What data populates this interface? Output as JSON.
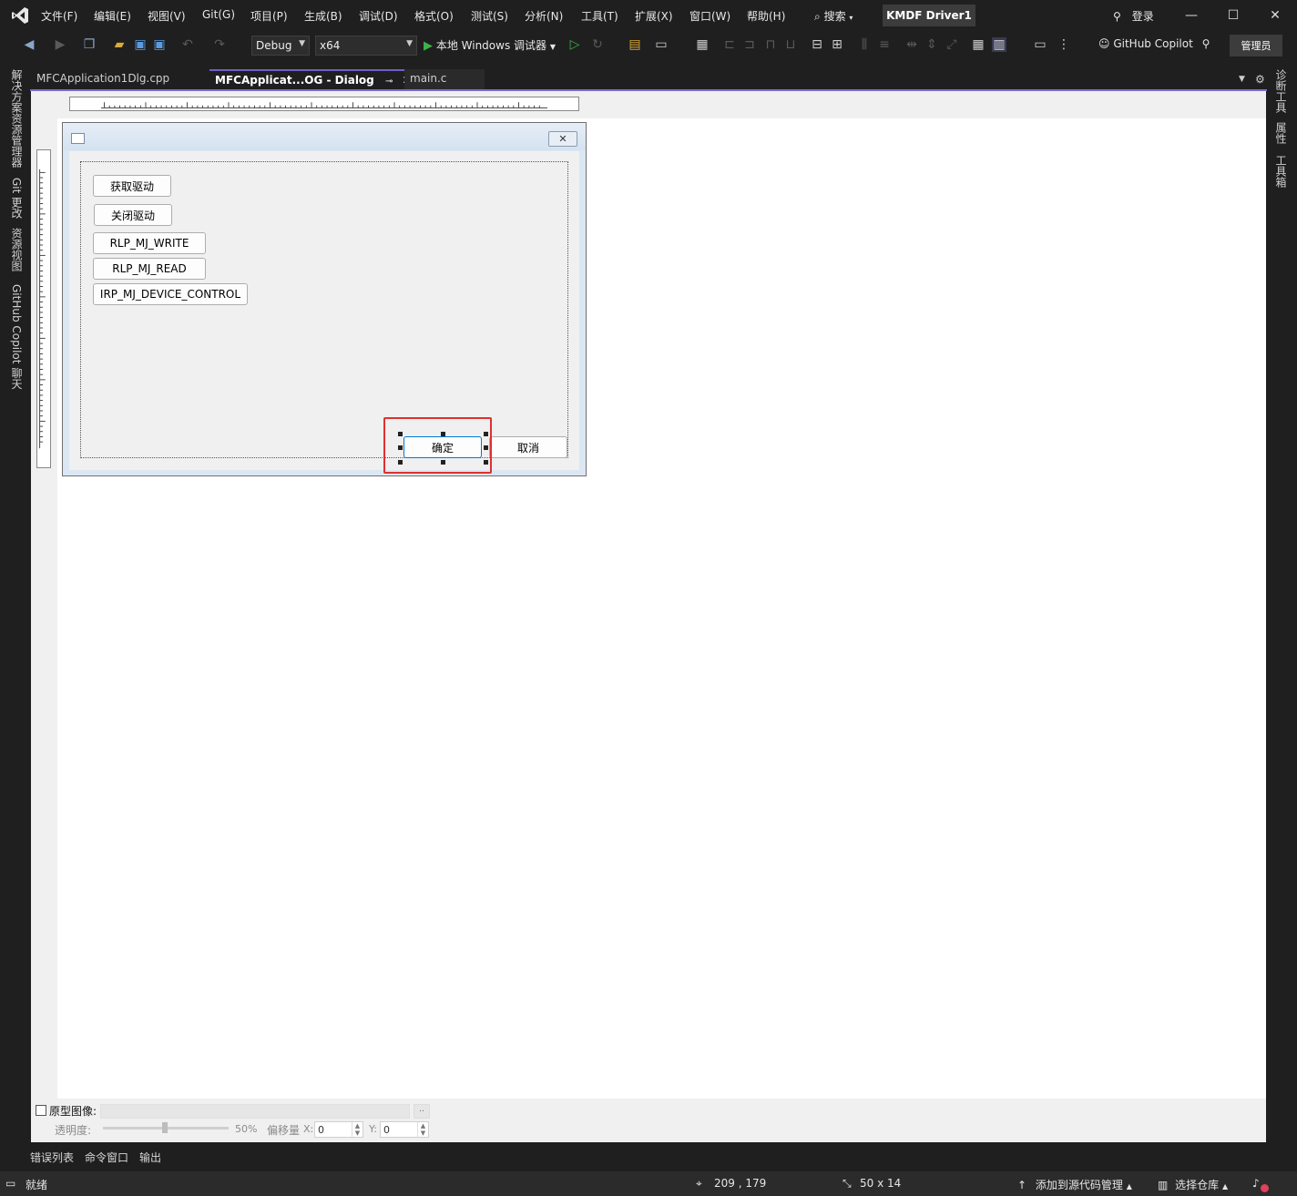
{
  "menu": [
    "文件(F)",
    "编辑(E)",
    "视图(V)",
    "Git(G)",
    "项目(P)",
    "生成(B)",
    "调试(D)",
    "格式(O)",
    "测试(S)",
    "分析(N)",
    "工具(T)",
    "扩展(X)",
    "窗口(W)",
    "帮助(H)"
  ],
  "search_label": "搜索",
  "project_name": "KMDF Driver1",
  "login_label": "登录",
  "toolbar": {
    "config": "Debug",
    "platform": "x64",
    "run_label": "本地 Windows 调试器",
    "copilot_label": "GitHub Copilot",
    "admin_label": "管理员"
  },
  "left_rail": [
    "解决方案资源管理器",
    "Git 更改",
    "资源视图",
    "GitHub Copilot 聊天"
  ],
  "right_rail": [
    "诊断工具",
    "属性",
    "工具箱"
  ],
  "tabs": [
    {
      "label": "MFCApplication1Dlg.cpp",
      "active": false
    },
    {
      "label": "MFCApplicat...OG - Dialog",
      "active": true
    },
    {
      "label": "main.c",
      "active": false
    }
  ],
  "dialog": {
    "buttons": [
      "获取驱动",
      "关闭驱动",
      "RLP_MJ_WRITE",
      "RLP_MJ_READ",
      "IRP_MJ_DEVICE_CONTROL"
    ],
    "ok_label": "确定",
    "cancel_label": "取消"
  },
  "prototype": {
    "label": "原型图像:",
    "opacity_label": "透明度:",
    "opacity_value": "50%",
    "offset_label": "偏移量",
    "x_label": "X:",
    "x_value": "0",
    "y_label": "Y:",
    "y_value": "0"
  },
  "bottom_tabs": [
    "错误列表",
    "命令窗口",
    "输出"
  ],
  "status": {
    "ready": "就绪",
    "position": "209 , 179",
    "size": "50 x 14",
    "add_source": "添加到源代码管理",
    "select_repo": "选择仓库"
  },
  "colors": {
    "accent": "#7a6ccf",
    "selection": "#e03030",
    "ok_border": "#0078d7"
  }
}
